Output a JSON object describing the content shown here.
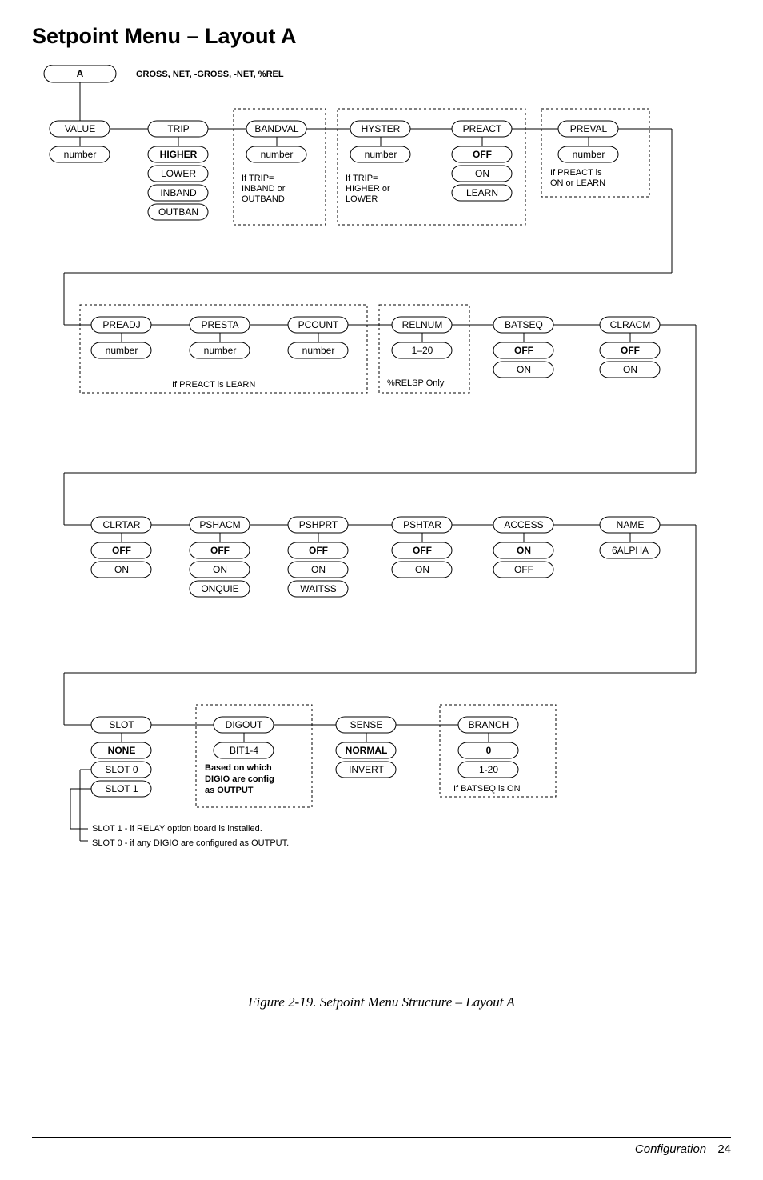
{
  "title": "Setpoint Menu – Layout A",
  "header": {
    "node": "A",
    "label": "GROSS, NET, -GROSS, -NET, %REL"
  },
  "row1": {
    "c1": {
      "head": "VALUE",
      "opts": [
        "number"
      ]
    },
    "c2": {
      "head": "TRIP",
      "opts": [
        "HIGHER",
        "LOWER",
        "INBAND",
        "OUTBAN"
      ]
    },
    "c3": {
      "head": "BANDVAL",
      "opts": [
        "number"
      ],
      "note": "If TRIP= INBAND or OUTBAND"
    },
    "c4": {
      "head": "HYSTER",
      "opts": [
        "number"
      ],
      "note": "If TRIP= HIGHER or LOWER"
    },
    "c5": {
      "head": "PREACT",
      "opts": [
        "OFF",
        "ON",
        "LEARN"
      ]
    },
    "c6": {
      "head": "PREVAL",
      "opts": [
        "number"
      ],
      "note": "If PREACT is ON or LEARN"
    }
  },
  "row2": {
    "c1": {
      "head": "PREADJ",
      "opts": [
        "number"
      ]
    },
    "c2": {
      "head": "PRESTA",
      "opts": [
        "number"
      ]
    },
    "c3": {
      "head": "PCOUNT",
      "opts": [
        "number"
      ]
    },
    "note12": "If PREACT is LEARN",
    "c4": {
      "head": "RELNUM",
      "opts": [
        "1–20"
      ],
      "note": "%RELSP Only"
    },
    "c5": {
      "head": "BATSEQ",
      "opts": [
        "OFF",
        "ON"
      ]
    },
    "c6": {
      "head": "CLRACM",
      "opts": [
        "OFF",
        "ON"
      ]
    }
  },
  "row3": {
    "c1": {
      "head": "CLRTAR",
      "opts": [
        "OFF",
        "ON"
      ]
    },
    "c2": {
      "head": "PSHACM",
      "opts": [
        "OFF",
        "ON",
        "ONQUIE"
      ]
    },
    "c3": {
      "head": "PSHPRT",
      "opts": [
        "OFF",
        "ON",
        "WAITSS"
      ]
    },
    "c4": {
      "head": "PSHTAR",
      "opts": [
        "OFF",
        "ON"
      ]
    },
    "c5": {
      "head": "ACCESS",
      "opts": [
        "ON",
        "OFF"
      ]
    },
    "c6": {
      "head": "NAME",
      "opts": [
        "6ALPHA"
      ]
    }
  },
  "row4": {
    "c1": {
      "head": "SLOT",
      "opts": [
        "NONE",
        "SLOT 0",
        "SLOT 1"
      ]
    },
    "c2": {
      "head": "DIGOUT",
      "opts": [
        "BIT1-4"
      ],
      "note": "Based on which DIGIO are config as OUTPUT"
    },
    "c3": {
      "head": "SENSE",
      "opts": [
        "NORMAL",
        "INVERT"
      ]
    },
    "c4": {
      "head": "BRANCH",
      "opts": [
        "0",
        "1-20"
      ],
      "note": "If BATSEQ is ON"
    }
  },
  "footnotes": [
    "SLOT 1 - if RELAY option board is installed.",
    "SLOT 0 - if any DIGIO are configured as OUTPUT."
  ],
  "caption": "Figure 2-19. Setpoint Menu Structure – Layout A",
  "footer": {
    "section": "Configuration",
    "page": "24"
  }
}
